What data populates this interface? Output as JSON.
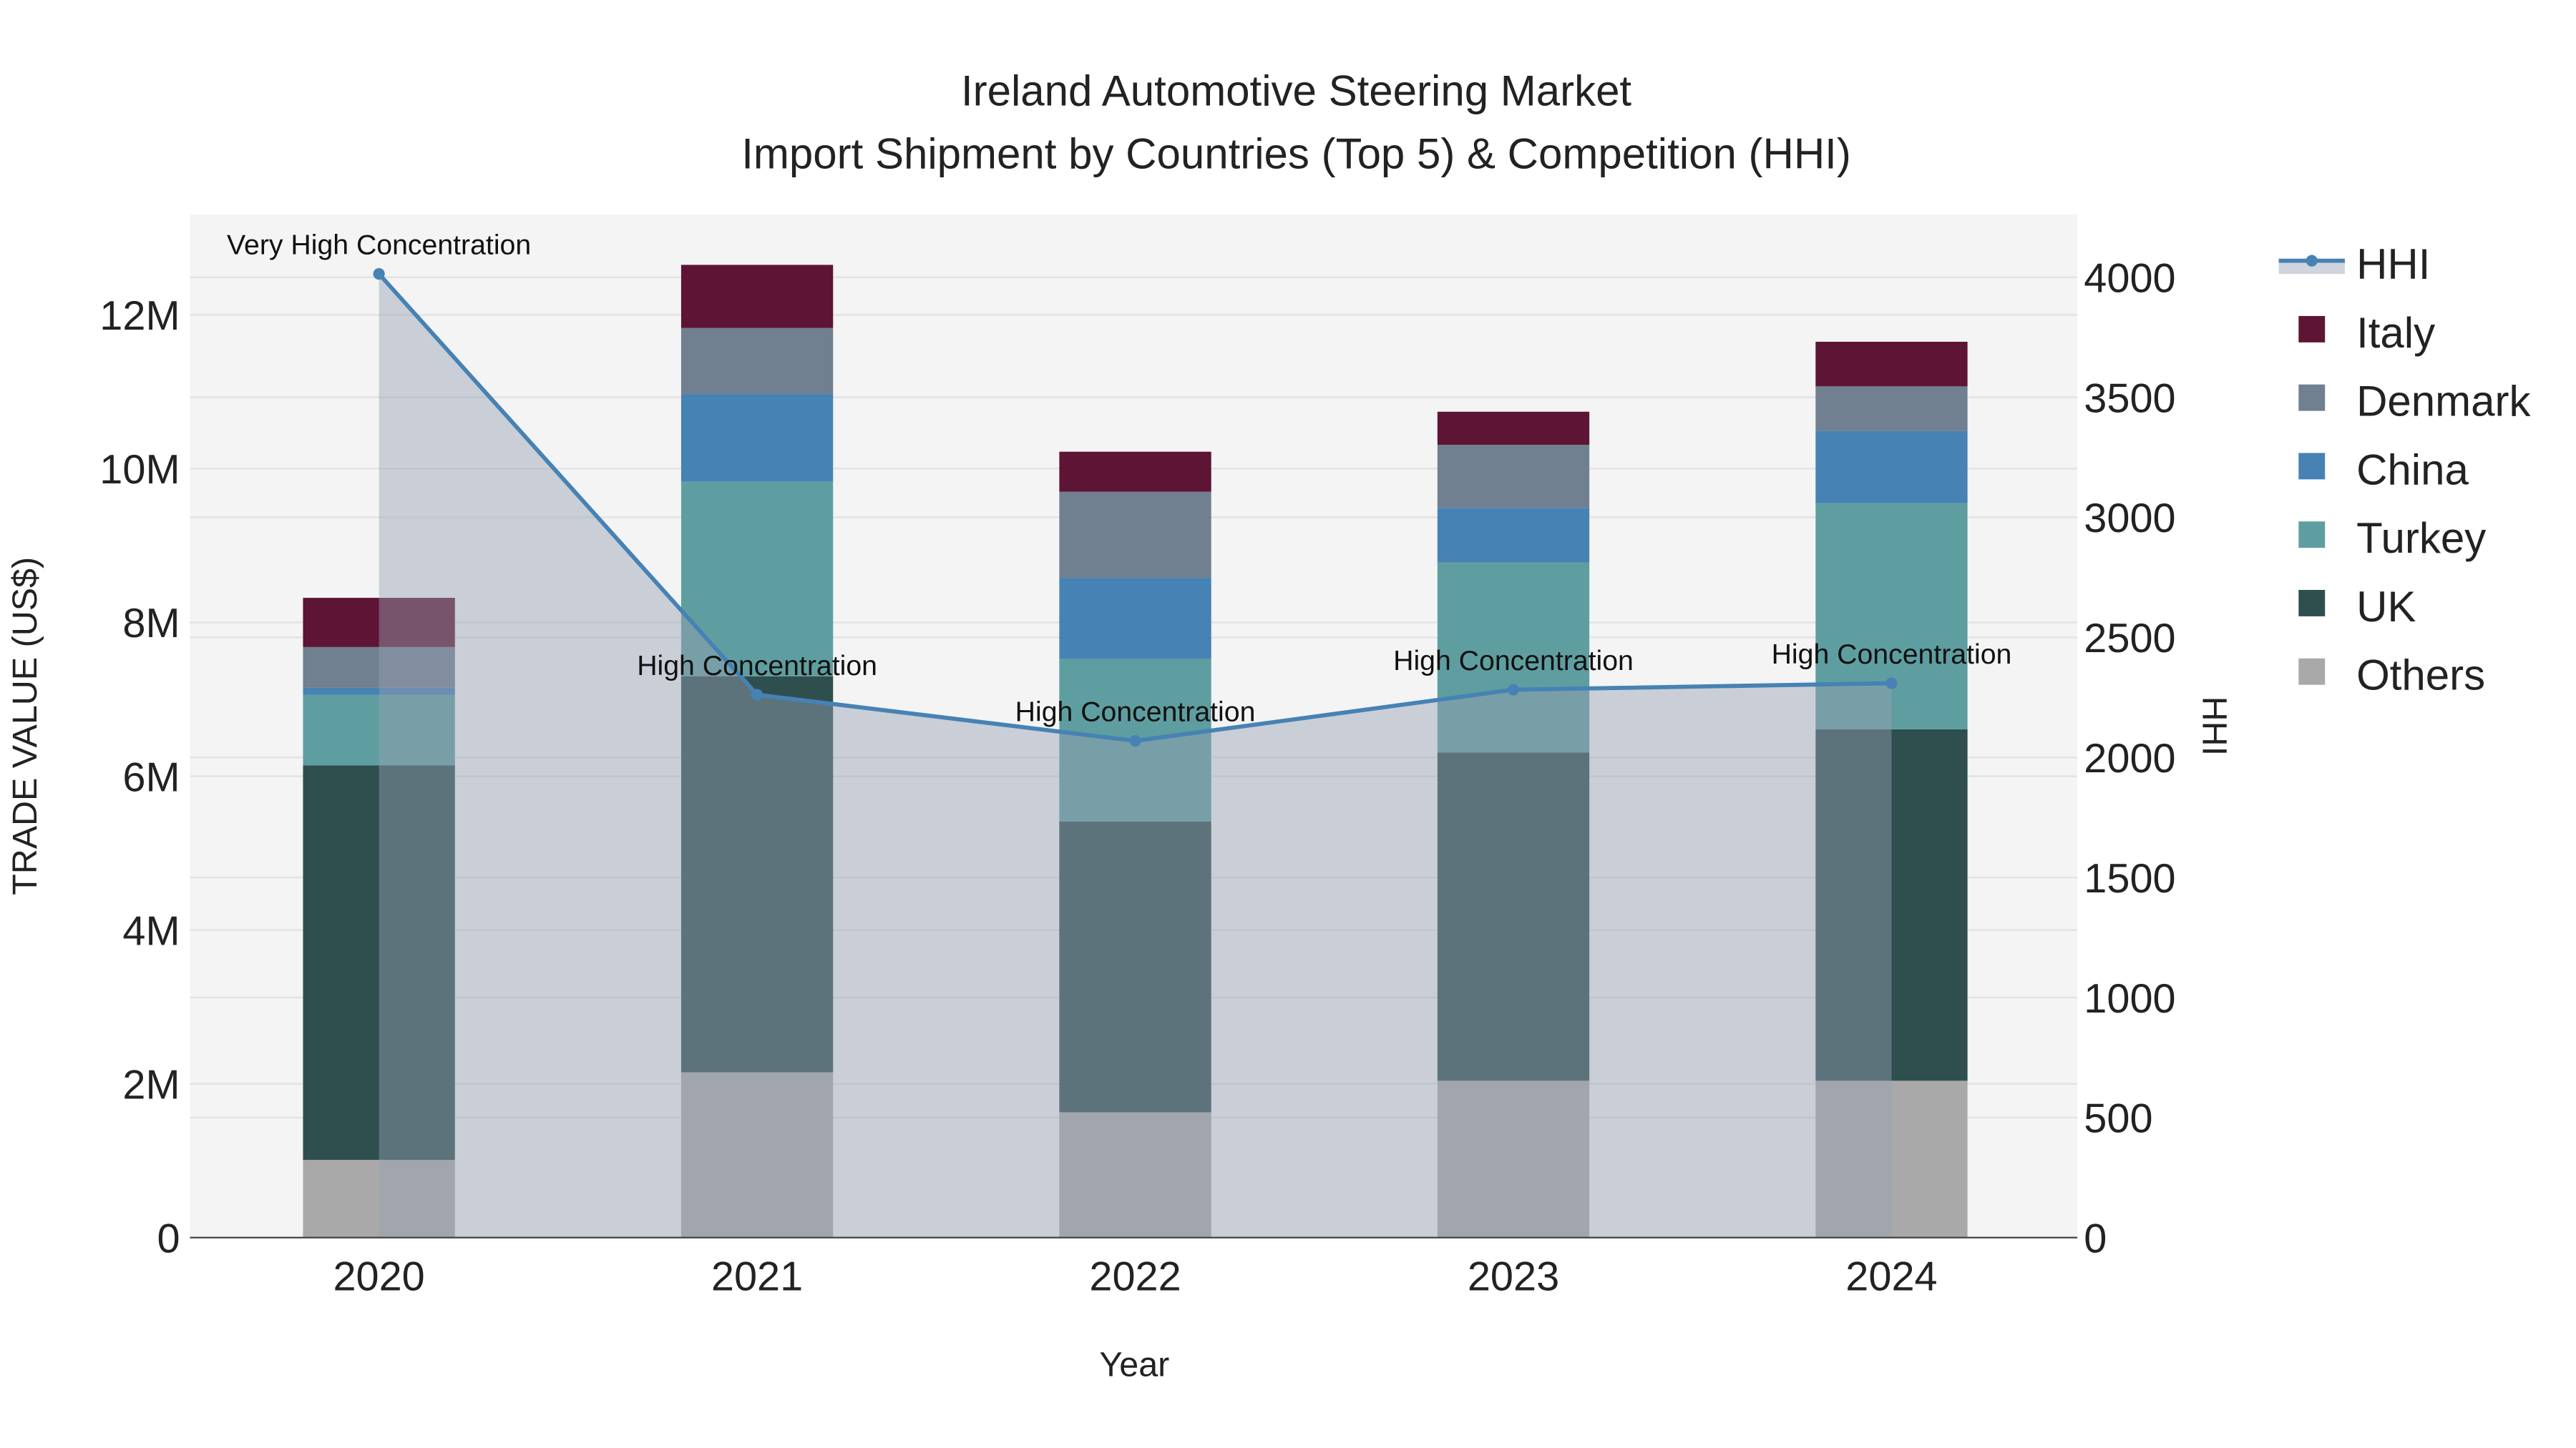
{
  "chart_data": {
    "type": "bar",
    "stacked": true,
    "title": "Ireland Automotive Steering Market",
    "subtitle": "Import Shipment by Countries (Top 5) & Competition (HHI)",
    "xlabel": "Year",
    "ylabel": "TRADE VALUE (US$)",
    "y2label": "HHI",
    "categories": [
      "2020",
      "2021",
      "2022",
      "2023",
      "2024"
    ],
    "ylim": [
      0,
      13000000
    ],
    "y2lim": [
      0,
      4250
    ],
    "yticks": [
      0,
      2000000,
      4000000,
      6000000,
      8000000,
      10000000,
      12000000
    ],
    "ytick_labels": [
      "0",
      "2M",
      "4M",
      "6M",
      "8M",
      "10M",
      "12M"
    ],
    "y2ticks": [
      0,
      500,
      1000,
      1500,
      2000,
      2500,
      3000,
      3500,
      4000
    ],
    "y2tick_labels": [
      "0",
      "500",
      "1000",
      "1500",
      "2000",
      "2500",
      "3000",
      "3500",
      "4000"
    ],
    "grid": true,
    "legend_position": "right",
    "series": [
      {
        "name": "Others",
        "color": "#a9a9a9",
        "values": [
          1010000,
          2150000,
          1630000,
          2040000,
          2040000
        ]
      },
      {
        "name": "UK",
        "color": "#2f4f4f",
        "values": [
          5130000,
          5150000,
          3780000,
          4270000,
          4570000
        ]
      },
      {
        "name": "Turkey",
        "color": "#5f9ea0",
        "values": [
          920000,
          2530000,
          2120000,
          2470000,
          2940000
        ]
      },
      {
        "name": "China",
        "color": "#4682b4",
        "values": [
          90000,
          1140000,
          1050000,
          710000,
          940000
        ]
      },
      {
        "name": "Denmark",
        "color": "#708090",
        "values": [
          530000,
          860000,
          1120000,
          820000,
          580000
        ]
      },
      {
        "name": "Italy",
        "color": "#5e1434",
        "values": [
          640000,
          820000,
          520000,
          430000,
          580000
        ]
      }
    ],
    "hhi": {
      "name": "HHI",
      "color": "#4682b4",
      "values": [
        4014,
        2261,
        2069,
        2282,
        2309
      ],
      "annotations": [
        "Very High Concentration",
        "High Concentration",
        "High Concentration",
        "High Concentration",
        "High Concentration"
      ]
    },
    "legend_order": [
      "HHI",
      "Italy",
      "Denmark",
      "China",
      "Turkey",
      "UK",
      "Others"
    ]
  }
}
